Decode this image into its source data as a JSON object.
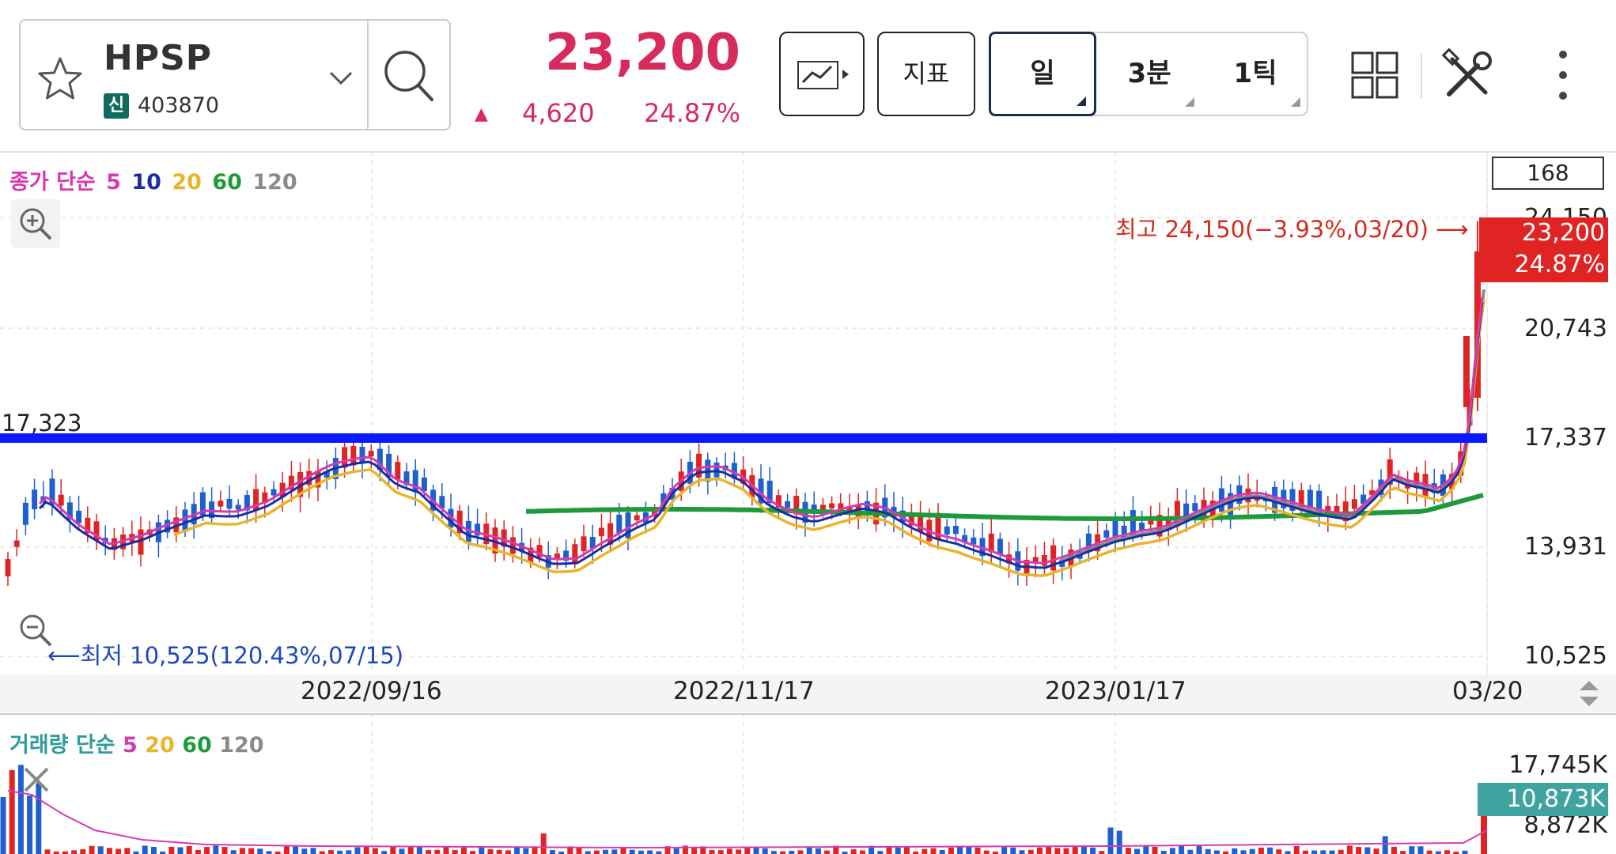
{
  "symbol": {
    "name": "HPSP",
    "badge": "신",
    "code": "403870"
  },
  "quote": {
    "price": "23,200",
    "arrow": "▲",
    "change": "4,620",
    "rate": "24.87%"
  },
  "toolbar": {
    "indicator_label": "지표",
    "periods": [
      "일",
      "3분",
      "1틱"
    ],
    "active_period": "일"
  },
  "icons": {
    "favorite": "star-icon",
    "dropdown": "chevron-down-icon",
    "search": "search-icon",
    "chart_type": "line-chart-icon",
    "layout": "grid-layout-icon",
    "tools": "tools-icon",
    "more": "more-vertical-icon",
    "zoom_in": "zoom-in-icon",
    "zoom_out": "zoom-out-icon",
    "close": "close-icon",
    "scroll": "scroll-updown-icon"
  },
  "price_chart": {
    "legend_prefix": "종가 단순",
    "ma_periods": [
      "5",
      "10",
      "20",
      "60",
      "120"
    ],
    "ma_colors": [
      "#d63ab0",
      "#1a2ea0",
      "#e8b52a",
      "#1f9a3a",
      "#8a8a8a"
    ],
    "visible_count": "168",
    "y_ticks": [
      "24,150",
      "20,743",
      "17,337",
      "13,931",
      "10,525"
    ],
    "current_price_tag": "23,200",
    "current_rate_tag": "24.87%",
    "high_label": "최고 24,150(−3.93%,03/20) ⟶",
    "low_label": "⟵최저 10,525(120.43%,07/15)",
    "hline_label": "17,323",
    "x_labels": [
      "2022/09/16",
      "2022/11/17",
      "2023/01/17",
      "03/20"
    ],
    "up_color": "#e02424",
    "down_color": "#1f5fd0",
    "hline_color": "#0a1aff"
  },
  "volume_chart": {
    "legend_prefix": "거래량 단순",
    "ma_periods": [
      "5",
      "20",
      "60",
      "120"
    ],
    "ma_colors": [
      "#d63ab0",
      "#e8b52a",
      "#1f9a3a",
      "#8a8a8a"
    ],
    "y_ticks": [
      "17,745K",
      "8,872K"
    ],
    "current_tag": "10,873K"
  },
  "chart_data": {
    "type": "candlestick",
    "x_range": [
      "2022/07/15",
      "2023/03/20"
    ],
    "y_range": [
      10525,
      24150
    ],
    "last_bar": {
      "date": "03/20",
      "close": 23200,
      "high": 24150,
      "change": 4620,
      "rate": "24.87%"
    },
    "period_low": {
      "date": "07/15",
      "value": 10525
    },
    "period_high": {
      "date": "03/20",
      "value": 24150
    },
    "horizontal_line": 17323,
    "last_volume": "10,873K"
  }
}
